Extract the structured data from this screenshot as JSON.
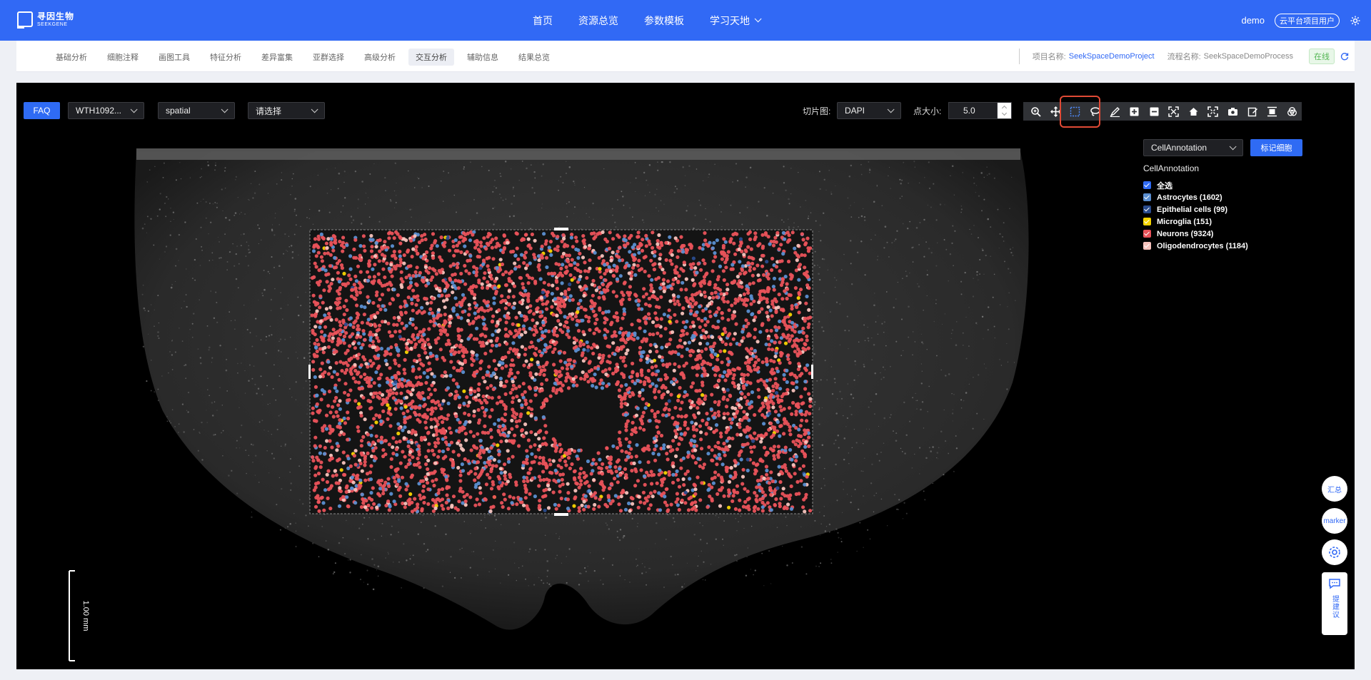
{
  "brand": {
    "name_cn": "寻因生物",
    "name_en": "SEEKGENE"
  },
  "nav": {
    "items": [
      "首页",
      "资源总览",
      "参数模板",
      "学习天地"
    ]
  },
  "user": {
    "name": "demo",
    "badge": "云平台项目用户"
  },
  "tabs": [
    "基础分析",
    "细胞注释",
    "画图工具",
    "特征分析",
    "差异富集",
    "亚群选择",
    "高级分析",
    "交互分析",
    "辅助信息",
    "结果总览"
  ],
  "active_tab": "交互分析",
  "project": {
    "project_label": "项目名称:",
    "project_name": "SeekSpaceDemoProject",
    "process_label": "流程名称:",
    "process_name": "SeekSpaceDemoProcess",
    "status": "在线"
  },
  "controls": {
    "faq": "FAQ",
    "sample": "WTH1092...",
    "embedding": "spatial",
    "group_placeholder": "请选择",
    "slice_label": "切片图:",
    "slice_value": "DAPI",
    "point_label": "点大小:",
    "point_value": "5.0"
  },
  "toolbar_icons": [
    "zoom-icon",
    "pan-icon",
    "box-select-icon",
    "lasso-select-icon",
    "draw-icon",
    "zoom-in-icon",
    "zoom-out-icon",
    "autoscale-icon",
    "home-icon",
    "fullscreen-icon",
    "camera-icon",
    "edit-icon",
    "fit-icon",
    "overlap-icon"
  ],
  "legend": {
    "selector": "CellAnnotation",
    "mark_button": "标记细胞",
    "title": "CellAnnotation",
    "items": [
      {
        "label": "全选",
        "color": "#2f6bf4"
      },
      {
        "label": "Astrocytes (1602)",
        "color": "#5b8fd1"
      },
      {
        "label": "Epithelial cells (99)",
        "color": "#2a4c8e"
      },
      {
        "label": "Microglia (151)",
        "color": "#f6d400"
      },
      {
        "label": "Neurons (9324)",
        "color": "#e9525a"
      },
      {
        "label": "Oligodendrocytes (1184)",
        "color": "#f7c3bd"
      }
    ]
  },
  "scale_bar": "1.00 mm",
  "float_buttons": {
    "summary": "汇总",
    "marker": "marker",
    "feedback": "提建议"
  }
}
